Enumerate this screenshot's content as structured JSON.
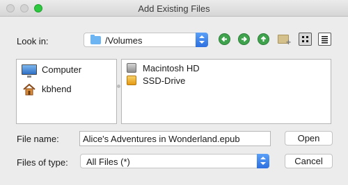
{
  "window": {
    "title": "Add Existing Files"
  },
  "look_in": {
    "label": "Look in:",
    "value": "/Volumes",
    "icon": "folder-icon"
  },
  "toolbar": {
    "buttons": [
      {
        "name": "back-button",
        "icon": "arrow-left-icon"
      },
      {
        "name": "forward-button",
        "icon": "arrow-right-icon"
      },
      {
        "name": "up-folder-button",
        "icon": "arrow-up-icon"
      },
      {
        "name": "new-folder-button",
        "icon": "new-folder-icon"
      },
      {
        "name": "icon-view-button",
        "icon": "grid-view-icon"
      },
      {
        "name": "list-view-button",
        "icon": "list-view-icon"
      }
    ]
  },
  "sidebar": {
    "items": [
      {
        "label": "Computer",
        "icon": "computer-icon"
      },
      {
        "label": "kbhend",
        "icon": "home-icon"
      }
    ]
  },
  "files": {
    "items": [
      {
        "label": "Macintosh HD",
        "icon": "hard-drive-icon"
      },
      {
        "label": "SSD-Drive",
        "icon": "external-drive-icon"
      }
    ]
  },
  "file_name": {
    "label": "File name:",
    "value": "Alice's Adventures in Wonderland.epub"
  },
  "file_type": {
    "label": "Files of type:",
    "value": "All Files (*)"
  },
  "actions": {
    "open_label": "Open",
    "cancel_label": "Cancel"
  },
  "colors": {
    "accent": "#2c6fe0",
    "nav_green": "#3fa34d",
    "window_bg": "#ececec"
  }
}
